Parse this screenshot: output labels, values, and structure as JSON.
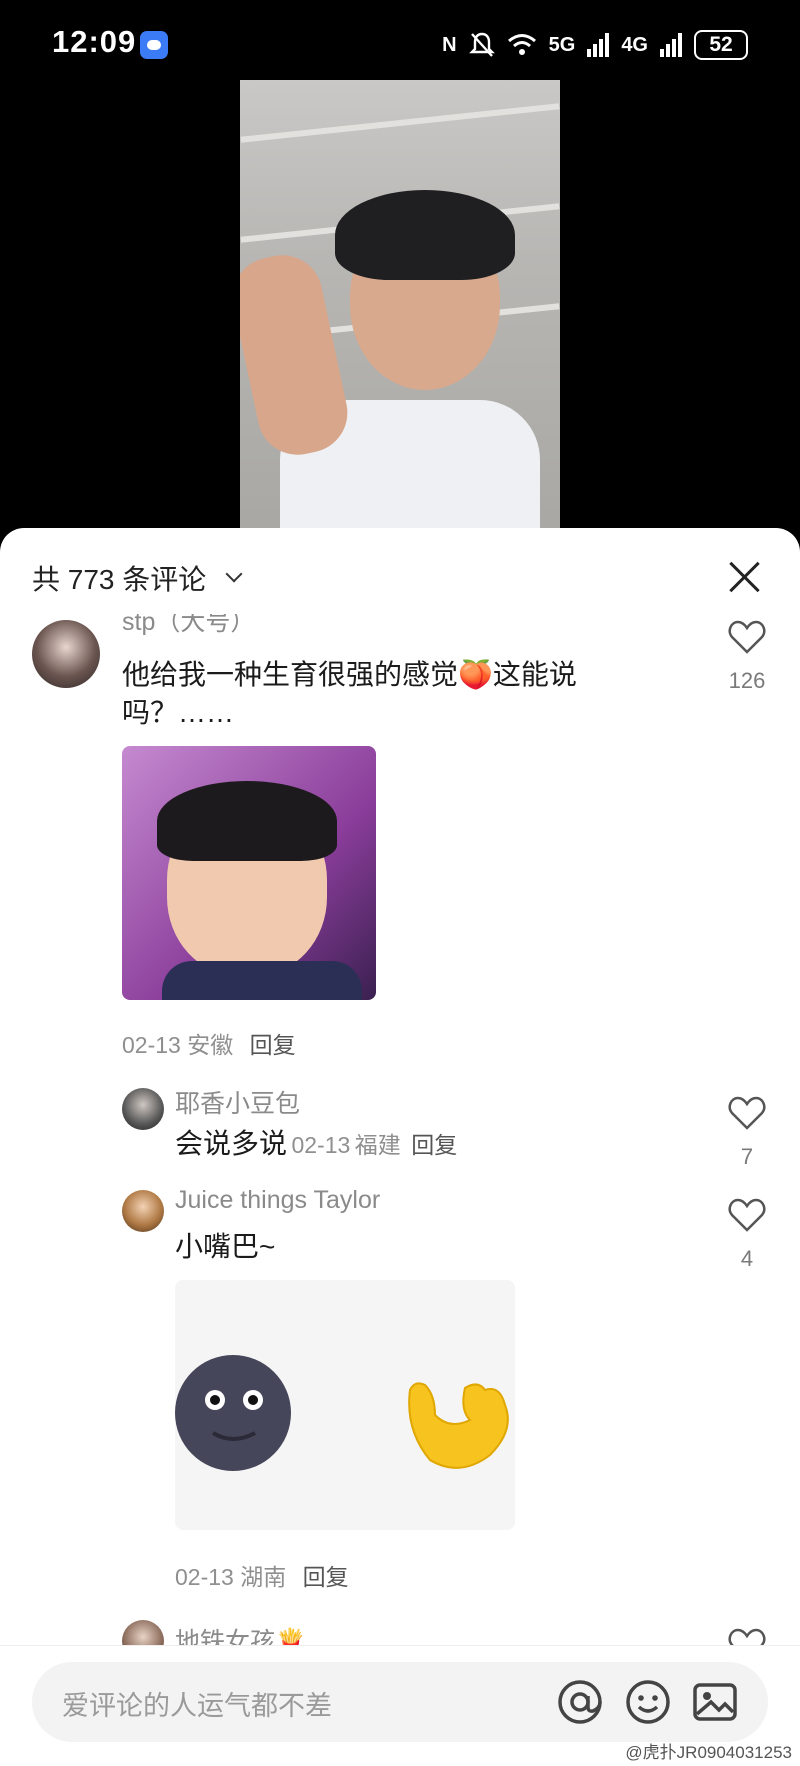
{
  "status_bar": {
    "time": "12:09",
    "network_5g": "5G",
    "network_4g": "4G",
    "battery": "52"
  },
  "comments_panel": {
    "title": "共 773 条评论",
    "comments": [
      {
        "username": "stp（大号）",
        "text": "他给我一种生育很强的感觉🍑这能说吗？……",
        "date": "02-13",
        "location": "安徽",
        "reply_label": "回复",
        "likes": "126"
      }
    ],
    "replies": [
      {
        "username": "耶香小豆包",
        "text": "会说多说",
        "date": "02-13",
        "location": "福建",
        "reply_label": "回复",
        "likes": "7"
      },
      {
        "username": "Juice things Taylor",
        "text": "小嘴巴~",
        "date": "02-13",
        "location": "湖南",
        "reply_label": "回复",
        "likes": "4"
      }
    ],
    "next_comment_username": "地铁女孩🍟"
  },
  "input_bar": {
    "placeholder": "爱评论的人运气都不差",
    "icons": [
      "at-icon",
      "emoji-icon",
      "image-icon"
    ]
  },
  "watermark": "@虎扑JR0904031253",
  "colors": {
    "sheet_bg": "#ffffff",
    "muted_text": "#8a8a8a",
    "primary_text": "#1b1b1b"
  }
}
